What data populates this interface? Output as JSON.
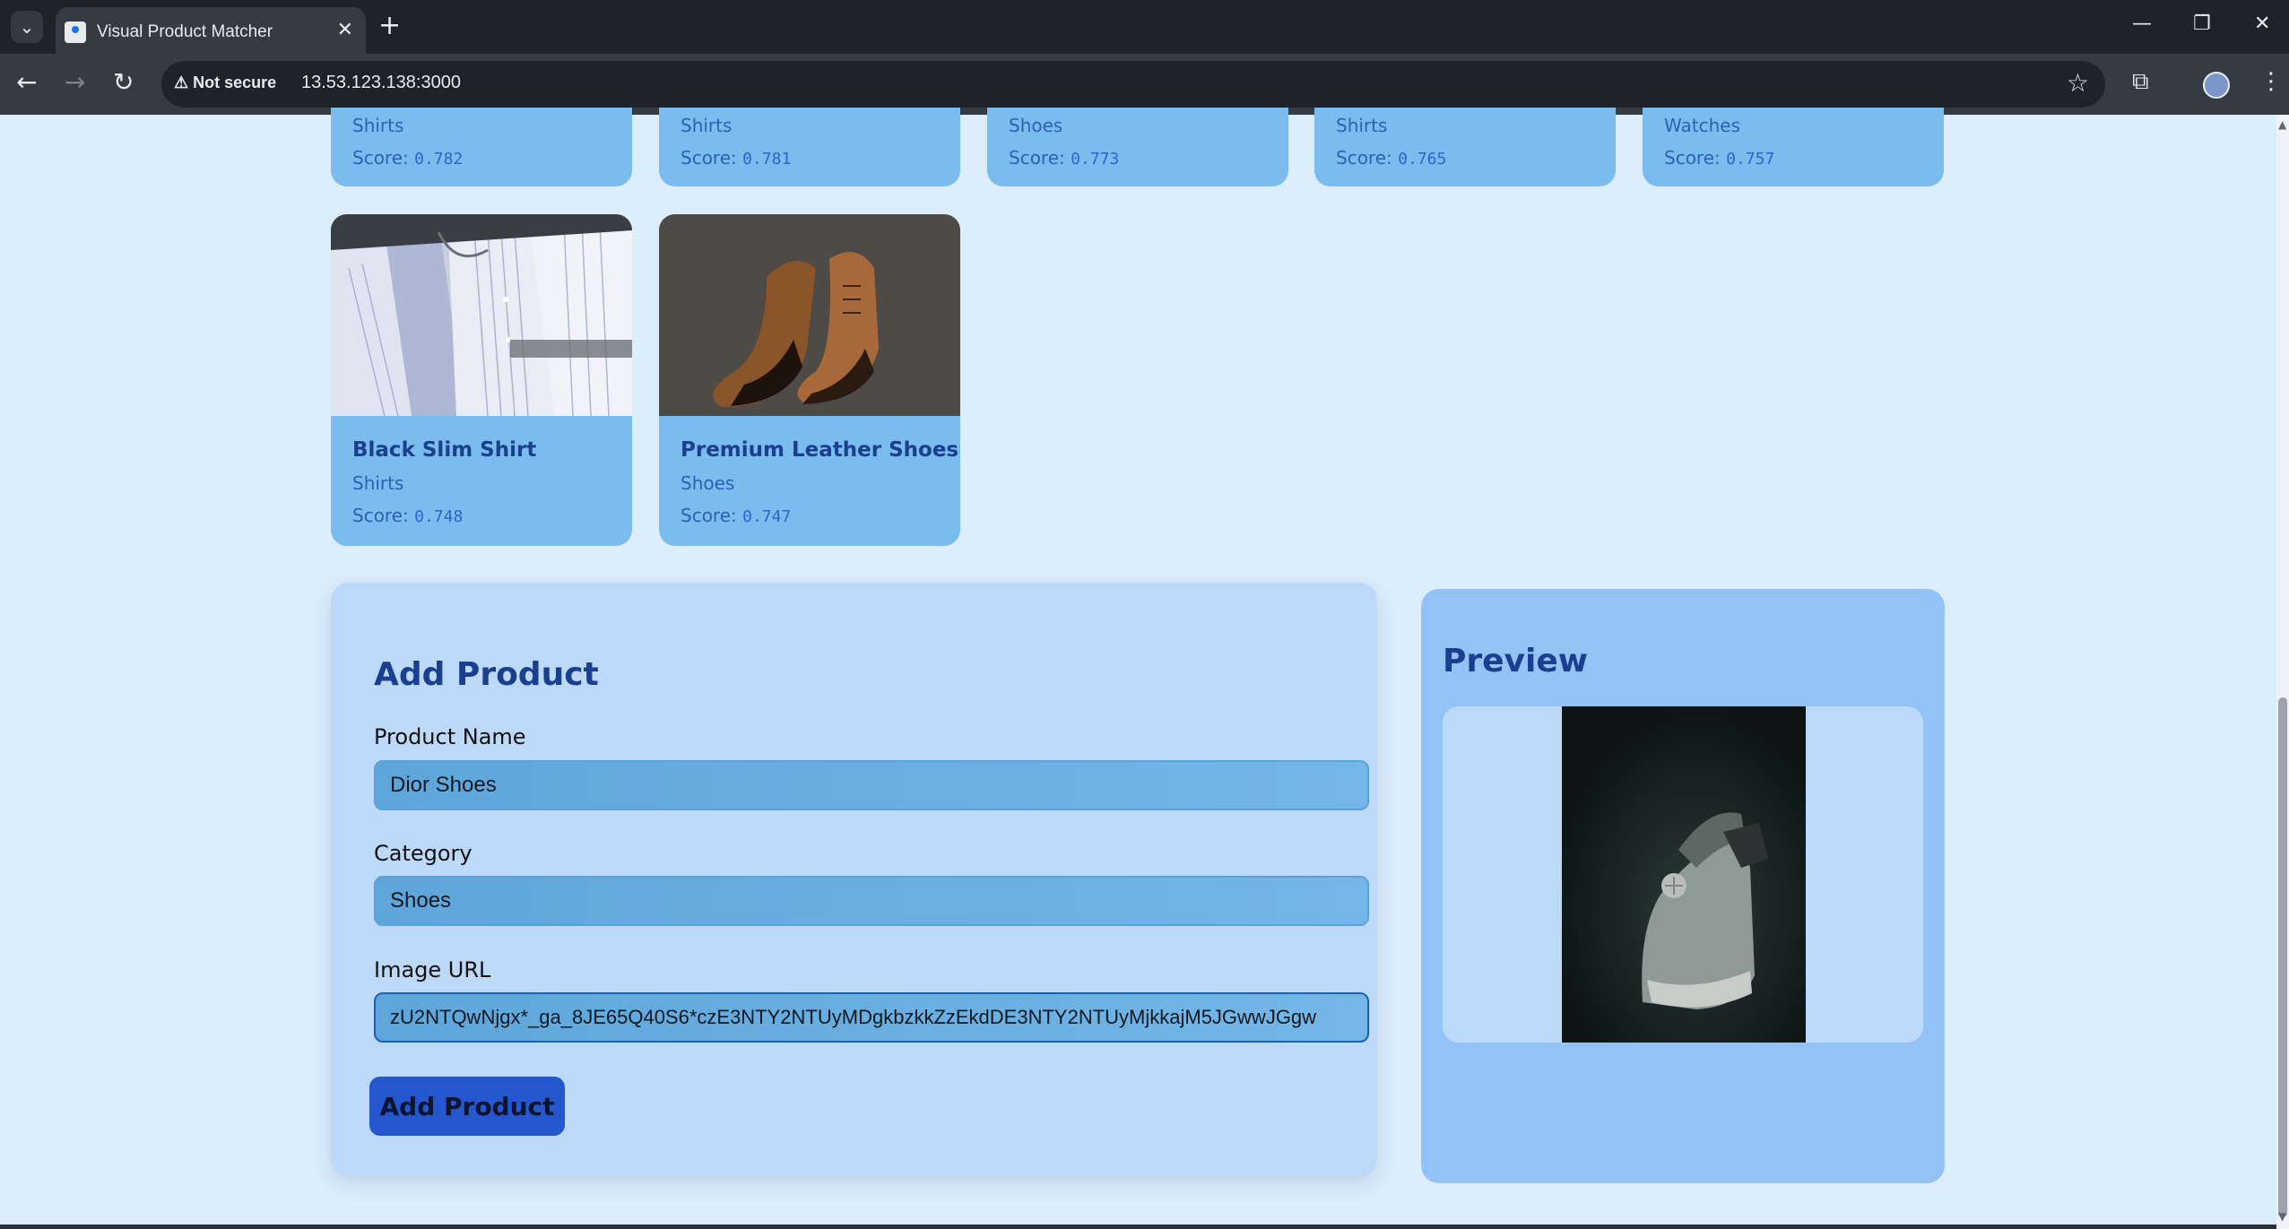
{
  "browser": {
    "tab_title": "Visual Product Matcher",
    "security_label": "Not secure",
    "url": "13.53.123.138:3000"
  },
  "results_partial": [
    {
      "category": "Shirts",
      "score_label": "Score:",
      "score": "0.782"
    },
    {
      "category": "Shirts",
      "score_label": "Score:",
      "score": "0.781"
    },
    {
      "category": "Shoes",
      "score_label": "Score:",
      "score": "0.773"
    },
    {
      "category": "Shirts",
      "score_label": "Score:",
      "score": "0.765"
    },
    {
      "category": "Watches",
      "score_label": "Score:",
      "score": "0.757"
    }
  ],
  "results": [
    {
      "name": "Black Slim Shirt",
      "category": "Shirts",
      "score_label": "Score:",
      "score": "0.748",
      "image": "shirts-photo"
    },
    {
      "name": "Premium Leather Shoes",
      "category": "Shoes",
      "score_label": "Score:",
      "score": "0.747",
      "image": "leather-shoes-photo"
    }
  ],
  "add_product": {
    "title": "Add Product",
    "name_label": "Product Name",
    "name_value": "Dior Shoes",
    "category_label": "Category",
    "category_value": "Shoes",
    "image_label": "Image URL",
    "image_value": "zU2NTQwNjgx*_ga_8JE65Q40S6*czE3NTY2NTUyMDgkbzkkZzEkdDE3NTY2NTUyMjkkajM5JGwwJGgw",
    "button_label": "Add Product"
  },
  "preview": {
    "title": "Preview",
    "image": "sneaker-photo"
  },
  "colors": {
    "page_bg": "#dcedfc",
    "card_bg": "#7bbcef",
    "form_bg": "#bdd9fa",
    "preview_bg": "#93c3f6",
    "button_bg": "#2457cf",
    "heading": "#1b3f8f"
  }
}
